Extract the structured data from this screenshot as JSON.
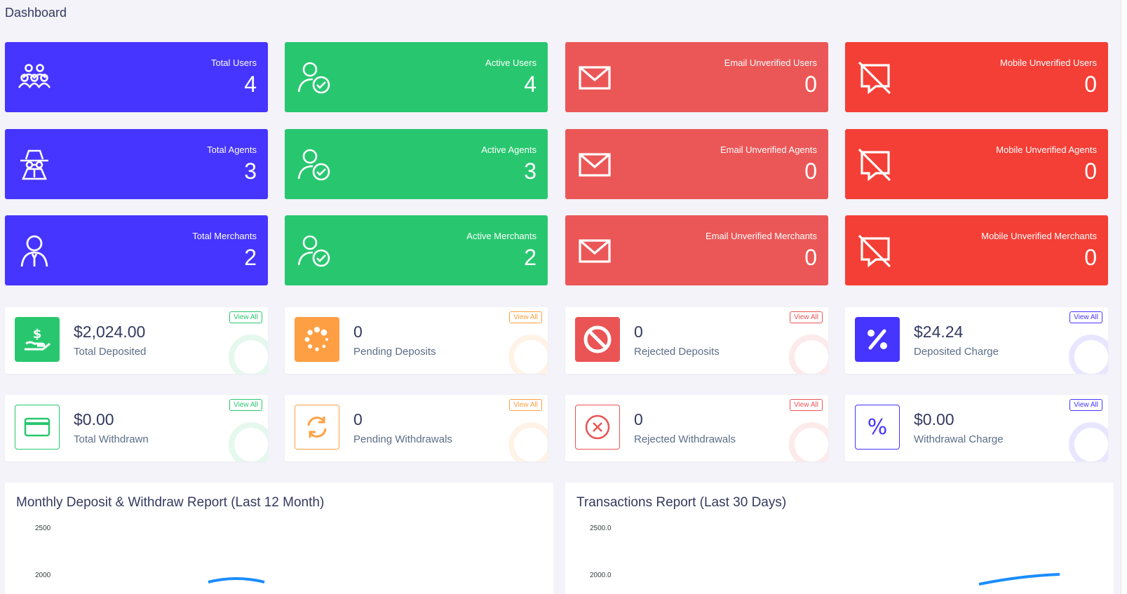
{
  "page": {
    "title": "Dashboard"
  },
  "widgets": [
    {
      "label": "Total Users",
      "value": "4",
      "icon": "users-group-icon",
      "color": "#4634ff"
    },
    {
      "label": "Active Users",
      "value": "4",
      "icon": "user-check-icon",
      "color": "#28c76f"
    },
    {
      "label": "Email Unverified Users",
      "value": "0",
      "icon": "envelope-icon",
      "color": "#eb5757"
    },
    {
      "label": "Mobile Unverified Users",
      "value": "0",
      "icon": "comment-slash-icon",
      "color": "#f43f36"
    },
    {
      "label": "Total Agents",
      "value": "3",
      "icon": "user-secret-icon",
      "color": "#4634ff"
    },
    {
      "label": "Active Agents",
      "value": "3",
      "icon": "user-check-icon",
      "color": "#28c76f"
    },
    {
      "label": "Email Unverified Agents",
      "value": "0",
      "icon": "envelope-icon",
      "color": "#eb5757"
    },
    {
      "label": "Mobile Unverified Agents",
      "value": "0",
      "icon": "comment-slash-icon",
      "color": "#f43f36"
    },
    {
      "label": "Total Merchants",
      "value": "2",
      "icon": "user-tie-icon",
      "color": "#4634ff"
    },
    {
      "label": "Active Merchants",
      "value": "2",
      "icon": "user-check-icon",
      "color": "#28c76f"
    },
    {
      "label": "Email Unverified Merchants",
      "value": "0",
      "icon": "envelope-icon",
      "color": "#eb5757"
    },
    {
      "label": "Mobile Unverified Merchants",
      "value": "0",
      "icon": "comment-slash-icon",
      "color": "#f43f36"
    }
  ],
  "stats": [
    {
      "value": "$2,024.00",
      "label": "Total Deposited",
      "button": "View All",
      "icon": "hand-dollar-icon"
    },
    {
      "value": "0",
      "label": "Pending Deposits",
      "button": "View All",
      "icon": "spinner-icon"
    },
    {
      "value": "0",
      "label": "Rejected Deposits",
      "button": "View All",
      "icon": "ban-icon"
    },
    {
      "value": "$24.24",
      "label": "Deposited Charge",
      "button": "View All",
      "icon": "percent-icon"
    },
    {
      "value": "$0.00",
      "label": "Total Withdrawn",
      "button": "View All",
      "icon": "credit-card-icon"
    },
    {
      "value": "0",
      "label": "Pending Withdrawals",
      "button": "View All",
      "icon": "sync-icon"
    },
    {
      "value": "0",
      "label": "Rejected Withdrawals",
      "button": "View All",
      "icon": "times-circle-icon"
    },
    {
      "value": "$0.00",
      "label": "Withdrawal Charge",
      "button": "View All",
      "icon": "percent-icon"
    }
  ],
  "charts": [
    {
      "title": "Monthly Deposit & Withdraw Report (Last 12 Month)",
      "y_ticks": [
        "2500",
        "2000"
      ]
    },
    {
      "title": "Transactions Report (Last 30 Days)",
      "y_ticks": [
        "2500.0",
        "2000.0"
      ]
    }
  ],
  "colors": {
    "blue": "#4634ff",
    "green": "#28c76f",
    "red": "#eb5757",
    "orange_red": "#f43f36",
    "orange": "#ff9f43"
  }
}
